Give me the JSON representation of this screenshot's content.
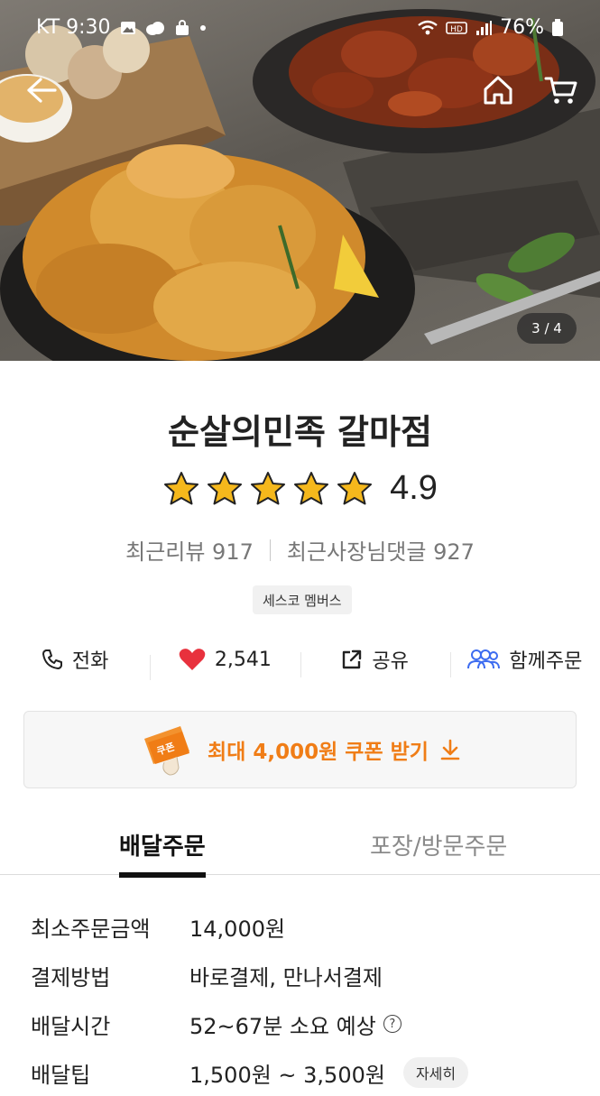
{
  "status_bar": {
    "carrier_time": "KT 9:30",
    "battery": "76%",
    "icons": [
      "image-icon",
      "cloud-icon",
      "bag-icon",
      "wifi-icon",
      "hd-icon",
      "signal-icon",
      "battery-icon"
    ]
  },
  "hero": {
    "pager": "3 / 4"
  },
  "store": {
    "name": "순살의민족 갈마점",
    "rating": "4.9",
    "stars": 5,
    "recent_reviews": "최근리뷰 917",
    "owner_replies": "최근사장님댓글 927",
    "badge": "세스코 멤버스"
  },
  "actions": {
    "call": "전화",
    "likes": "2,541",
    "share": "공유",
    "group_order": "함께주문"
  },
  "coupon": {
    "label": "최대 4,000원 쿠폰 받기",
    "ticket_text": "쿠폰"
  },
  "tabs": {
    "delivery": "배달주문",
    "pickup": "포장/방문주문"
  },
  "info": {
    "min_order_label": "최소주문금액",
    "min_order_value": "14,000원",
    "payment_label": "결제방법",
    "payment_value": "바로결제, 만나서결제",
    "time_label": "배달시간",
    "time_value": "52~67분 소요 예상",
    "tip_label": "배달팁",
    "tip_value": "1,500원 ~ 3,500원",
    "detail_button": "자세히"
  },
  "colors": {
    "accent_orange": "#f07d16",
    "heart_red": "#e8313d",
    "group_blue": "#3d6cf0",
    "star_gold": "#f5b81c"
  }
}
